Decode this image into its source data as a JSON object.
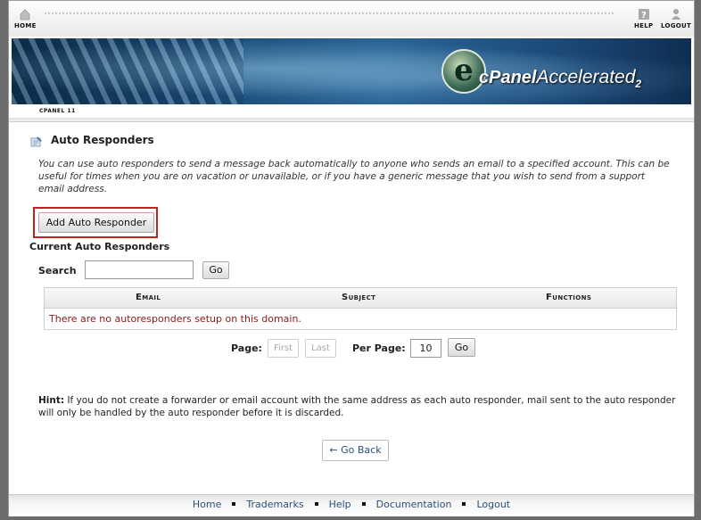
{
  "topbar": {
    "home_label": "HOME",
    "help_label": "HELP",
    "logout_label": "LOGOUT"
  },
  "banner": {
    "logo_letter": "e",
    "brand": "cPanel",
    "product": "Accelerated",
    "version": "2"
  },
  "breadcrumb": "CPANEL 11",
  "page": {
    "title": "Auto Responders",
    "description": "You can use auto responders to send a message back automatically to anyone who sends an email to a specified account. This can be useful for times when you are on vacation or unavailable, or if you have a generic message that you wish to send from a support email address.",
    "add_button": "Add Auto Responder",
    "current_heading": "Current Auto Responders"
  },
  "search": {
    "label": "Search",
    "value": "",
    "go_label": "Go"
  },
  "table": {
    "columns": [
      "Email",
      "Subject",
      "Functions"
    ],
    "empty_message": "There are no autoresponders setup on this domain."
  },
  "pagination": {
    "page_label": "Page:",
    "first_label": "First",
    "last_label": "Last",
    "per_page_label": "Per Page:",
    "per_page_value": "10",
    "go_label": "Go"
  },
  "hint": {
    "label": "Hint:",
    "text": " If you do not create a forwarder or email account with the same address as each auto responder, mail sent to the auto responder will only be handled by the auto responder before it is discarded."
  },
  "back_button": "← Go Back",
  "footer": {
    "links": [
      "Home",
      "Trademarks",
      "Help",
      "Documentation",
      "Logout"
    ]
  },
  "colors": {
    "highlight_border": "#c52020",
    "link": "#2a4f7a",
    "empty_text": "#8a1a1a"
  }
}
